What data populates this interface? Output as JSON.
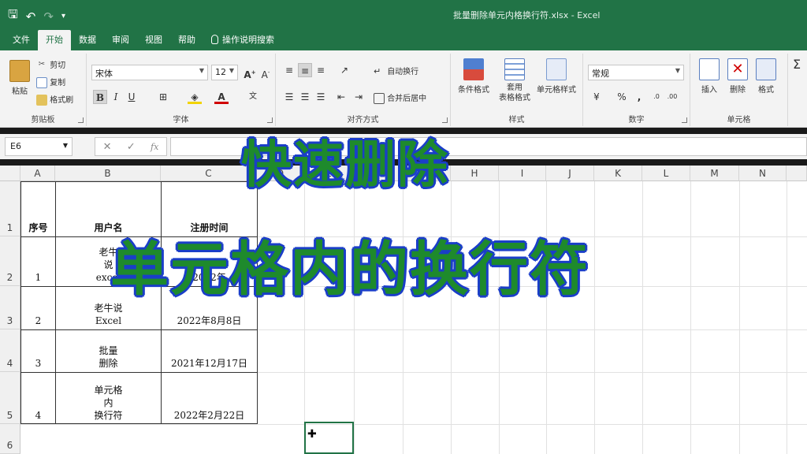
{
  "window": {
    "title": "批量删除单元内格换行符.xlsx  -  Excel"
  },
  "tabs": [
    "文件",
    "开始",
    "数据",
    "审阅",
    "视图",
    "帮助",
    "操作说明搜索"
  ],
  "active_tab": "开始",
  "ribbon": {
    "clipboard": {
      "cut": "剪切",
      "copy": "复制",
      "paste": "粘贴",
      "format_painter": "格式刷",
      "label": "剪贴板"
    },
    "font": {
      "name": "宋体",
      "size": "12",
      "label": "字体",
      "bold": "B",
      "italic": "I",
      "underline": "U"
    },
    "alignment": {
      "wrap": "自动换行",
      "merge": "合并后居中",
      "label": "对齐方式"
    },
    "styles": {
      "conditional": "条件格式",
      "table_line1": "套用",
      "table_line2": "表格格式",
      "cell_styles": "单元格样式",
      "label": "样式"
    },
    "number": {
      "format": "常规",
      "label": "数字"
    },
    "cells": {
      "insert": "插入",
      "delete": "删除",
      "format": "格式",
      "label": "单元格"
    }
  },
  "formula_bar": {
    "name_box": "E6",
    "fx": "fx",
    "value": ""
  },
  "columns": [
    "A",
    "B",
    "C",
    "D",
    "E",
    "F",
    "G",
    "H",
    "I",
    "J",
    "K",
    "L",
    "M",
    "N"
  ],
  "rows": [
    "1",
    "2",
    "3",
    "4",
    "5",
    "6"
  ],
  "table": {
    "header": {
      "a": "序号",
      "b": "用户名",
      "c": "注册时间"
    },
    "rows": [
      {
        "a": "1",
        "b": "老牛\n说\nexcel",
        "c": "2022年"
      },
      {
        "a": "2",
        "b": "老牛说\nExcel",
        "c": "2022年8月8日"
      },
      {
        "a": "3",
        "b": "批量\n删除",
        "c": "2021年12月17日"
      },
      {
        "a": "4",
        "b": "单元格\n内\n换行符",
        "c": "2022年2月22日"
      }
    ]
  },
  "overlay": {
    "line1": "快速删除",
    "line2": "单元格内的换行符"
  },
  "colors": {
    "excel_green": "#217346",
    "caption_fill": "#1e8a2c",
    "caption_outline": "#1a3ec8"
  }
}
